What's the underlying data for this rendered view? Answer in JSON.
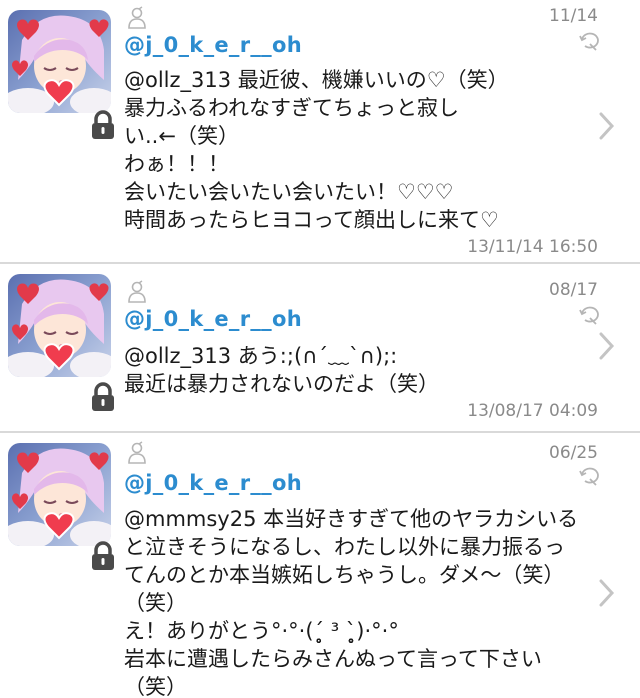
{
  "tweets": [
    {
      "username": "@j_0_k_e_r__oh",
      "date": "11/14",
      "lines": [
        "@ollz_313 最近彼、機嫌いいの♡（笑）",
        "暴力ふるわれなすぎてちょっと寂し",
        "い..←（笑）",
        "わぁ！！！",
        "会いたい会いたい会いたい！♡♡♡",
        "時間あったらヒヨコって顔出しに来て♡"
      ],
      "timestamp": "13/11/14 16:50"
    },
    {
      "username": "@j_0_k_e_r__oh",
      "date": "08/17",
      "lines": [
        "@ollz_313 あう:;(∩´﹏`∩);:",
        "最近は暴力されないのだよ（笑）"
      ],
      "timestamp": "13/08/17 04:09"
    },
    {
      "username": "@j_0_k_e_r__oh",
      "date": "06/25",
      "lines": [
        "@mmmsy25 本当好きすぎて他のヤラカシいる",
        "と泣きそうになるし、わたし以外に暴力振るっ",
        "てんのとか本当嫉妬しちゃうし。ダメ〜（笑）",
        "（笑）",
        "え！ありがとう°·°·(ˊ̥̥̥̥̥ ³ ˋ̥̥̥̥̥)·°·°",
        "岩本に遭遇したらみさんぬって言って下さい",
        "（笑）"
      ],
      "timestamp": ""
    }
  ],
  "colors": {
    "username": "#2c8ccf",
    "meta": "#8a8a8a",
    "separator": "#d9d9d9"
  },
  "icons": [
    "avatar",
    "lock-icon",
    "user-icon",
    "retweet-icon",
    "chevron-right-icon"
  ]
}
